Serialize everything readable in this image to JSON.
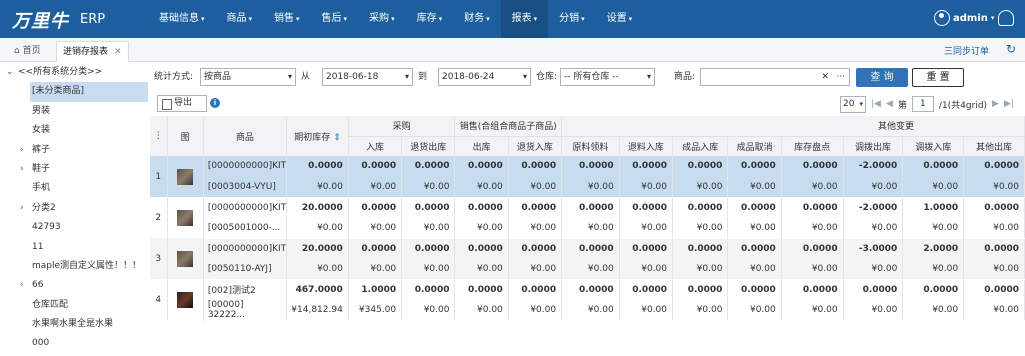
{
  "app": {
    "logo_text": "万里牛",
    "erp": "ERP",
    "user": "admin"
  },
  "nav": [
    "基础信息",
    "商品",
    "销售",
    "售后",
    "采购",
    "库存",
    "财务",
    "报表",
    "分销",
    "设置"
  ],
  "tabs": {
    "home": "首页",
    "current": "进销存报表"
  },
  "sync": "三同步订单",
  "sidebar": [
    "<<所有系统分类>>",
    "[未分类商品]",
    "男装",
    "女装",
    "裤子",
    "鞋子",
    "手机",
    "分类2",
    "42793",
    "11",
    "maple测自定义属性！！！",
    "66",
    "仓库匹配",
    "水果啊水果全是水果",
    "000"
  ],
  "filters": {
    "stat_label": "统计方式:",
    "stat_value": "按商品",
    "from_label": "从",
    "from_date": "2018-06-18",
    "to_label": "到",
    "to_date": "2018-06-24",
    "wh_label": "仓库:",
    "wh_value": "-- 所有仓库 --",
    "goods_label": "商品:",
    "goods_value": "",
    "query": "查 询",
    "reset": "重 置"
  },
  "toolbar": {
    "export": "导出",
    "page_size": "20",
    "page_prefix": "第",
    "page": "1",
    "page_suffix": "/1(共4grid)"
  },
  "table": {
    "group_headers": {
      "purchase": "采购",
      "sales": "销售(合组合商品子商品)",
      "other": "其他变更"
    },
    "columns": {
      "img": "图",
      "goods": "商品",
      "opening": "期初库存",
      "in": "入库",
      "purchase_out": "退货出库",
      "out": "出库",
      "return_in": "退货入库",
      "raw": "原料领料",
      "raw_return": "退料入库",
      "prod_in": "成品入库",
      "prod_cancel": "成品取消",
      "check": "库存盘点",
      "transfer_out": "调拨出库",
      "transfer_in": "调拨入库",
      "other_out": "其他出库"
    },
    "rows": [
      {
        "no": "1",
        "line1": "[0000000000]KIT",
        "line2": "[0003004-VYU]",
        "q": [
          "0.0000",
          "0.0000",
          "0.0000",
          "0.0000",
          "0.0000",
          "0.0000",
          "0.0000",
          "0.0000",
          "0.0000",
          "0.0000",
          "-2.0000",
          "0.0000",
          "0.0000"
        ],
        "a": [
          "¥0.00",
          "¥0.00",
          "¥0.00",
          "¥0.00",
          "¥0.00",
          "¥0.00",
          "¥0.00",
          "¥0.00",
          "¥0.00",
          "¥0.00",
          "¥0.00",
          "¥0.00",
          "¥0.00"
        ]
      },
      {
        "no": "2",
        "line1": "[0000000000]KIT",
        "line2": "[0005001000-...",
        "q": [
          "20.0000",
          "0.0000",
          "0.0000",
          "0.0000",
          "0.0000",
          "0.0000",
          "0.0000",
          "0.0000",
          "0.0000",
          "0.0000",
          "-2.0000",
          "1.0000",
          "0.0000"
        ],
        "a": [
          "¥0.00",
          "¥0.00",
          "¥0.00",
          "¥0.00",
          "¥0.00",
          "¥0.00",
          "¥0.00",
          "¥0.00",
          "¥0.00",
          "¥0.00",
          "¥0.00",
          "¥0.00",
          "¥0.00"
        ]
      },
      {
        "no": "3",
        "line1": "[0000000000]KIT",
        "line2": "[0050110-AYJ]",
        "q": [
          "20.0000",
          "0.0000",
          "0.0000",
          "0.0000",
          "0.0000",
          "0.0000",
          "0.0000",
          "0.0000",
          "0.0000",
          "0.0000",
          "-3.0000",
          "2.0000",
          "0.0000"
        ],
        "a": [
          "¥0.00",
          "¥0.00",
          "¥0.00",
          "¥0.00",
          "¥0.00",
          "¥0.00",
          "¥0.00",
          "¥0.00",
          "¥0.00",
          "¥0.00",
          "¥0.00",
          "¥0.00",
          "¥0.00"
        ]
      },
      {
        "no": "4",
        "line1": "[002]测试2",
        "line2": "[00000] 32222...",
        "q": [
          "467.0000",
          "1.0000",
          "0.0000",
          "0.0000",
          "0.0000",
          "0.0000",
          "0.0000",
          "0.0000",
          "0.0000",
          "0.0000",
          "0.0000",
          "0.0000",
          "0.0000"
        ],
        "a": [
          "¥14,812.94",
          "¥345.00",
          "¥0.00",
          "¥0.00",
          "¥0.00",
          "¥0.00",
          "¥0.00",
          "¥0.00",
          "¥0.00",
          "¥0.00",
          "¥0.00",
          "¥0.00",
          "¥0.00"
        ]
      }
    ]
  }
}
